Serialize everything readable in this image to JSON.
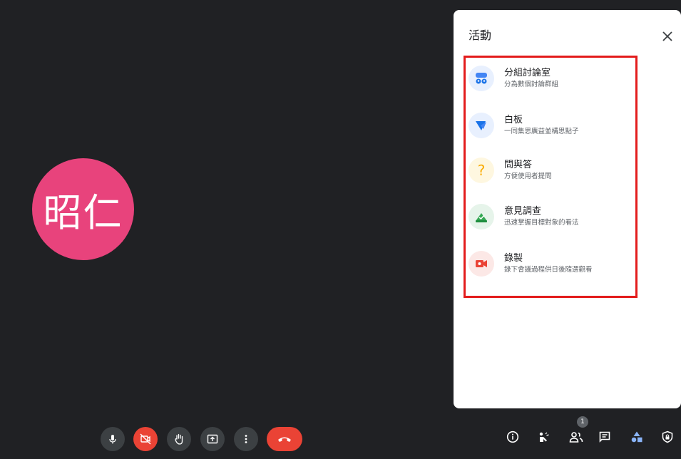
{
  "participant": {
    "initials": "昭仁",
    "avatar_color": "#e8437c"
  },
  "panel": {
    "title": "活動",
    "close_icon": "close-icon",
    "items": [
      {
        "title": "分組討論室",
        "subtitle": "分為數個討論群組",
        "icon": "breakout-rooms-icon"
      },
      {
        "title": "白板",
        "subtitle": "一同集思廣益並構思點子",
        "icon": "whiteboard-icon"
      },
      {
        "title": "問與答",
        "subtitle": "方便使用者提問",
        "icon": "qa-icon"
      },
      {
        "title": "意見調查",
        "subtitle": "迅速掌握目標對象的看法",
        "icon": "polls-icon"
      },
      {
        "title": "錄製",
        "subtitle": "錄下會議過程供日後隨選觀看",
        "icon": "recording-icon"
      }
    ]
  },
  "controls": {
    "mic": "mic-icon",
    "camera": "camera-off-icon",
    "raise_hand": "hand-icon",
    "present": "present-screen-icon",
    "more": "more-vert-icon",
    "leave": "call-end-icon"
  },
  "right_controls": {
    "participant_count": "1",
    "items": [
      "info-icon",
      "people-wave-icon",
      "people-icon",
      "chat-icon",
      "activities-icon",
      "host-controls-icon"
    ]
  },
  "colors": {
    "leave": "#ea4335",
    "activities_active": "#8ab4f8",
    "highlight_border": "#e31c1c"
  }
}
